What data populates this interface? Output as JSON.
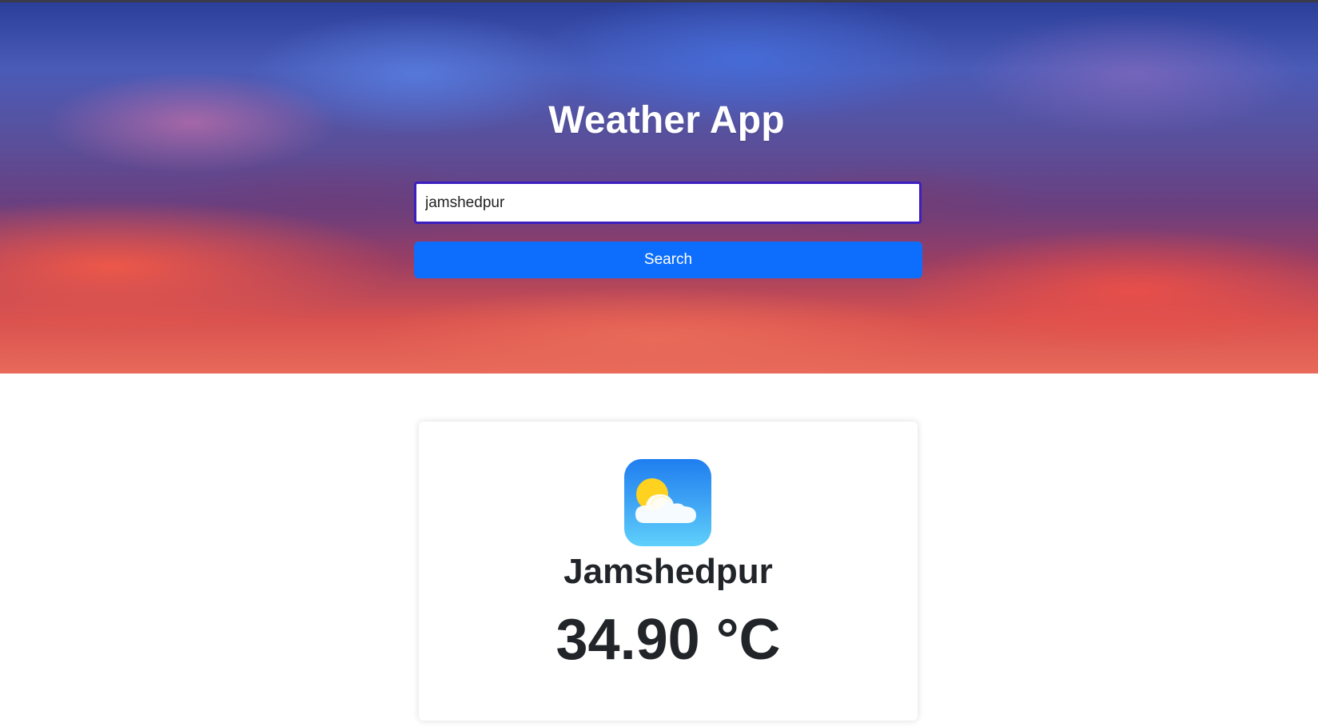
{
  "app": {
    "title": "Weather App"
  },
  "search": {
    "value": "jamshedpur",
    "button_label": "Search"
  },
  "weather": {
    "icon": "partly-cloudy-icon",
    "city": "Jamshedpur",
    "temperature": "34.90 °C"
  },
  "colors": {
    "button": "#0d6efd",
    "input_border": "#3c1fc0",
    "text_dark": "#212529"
  }
}
